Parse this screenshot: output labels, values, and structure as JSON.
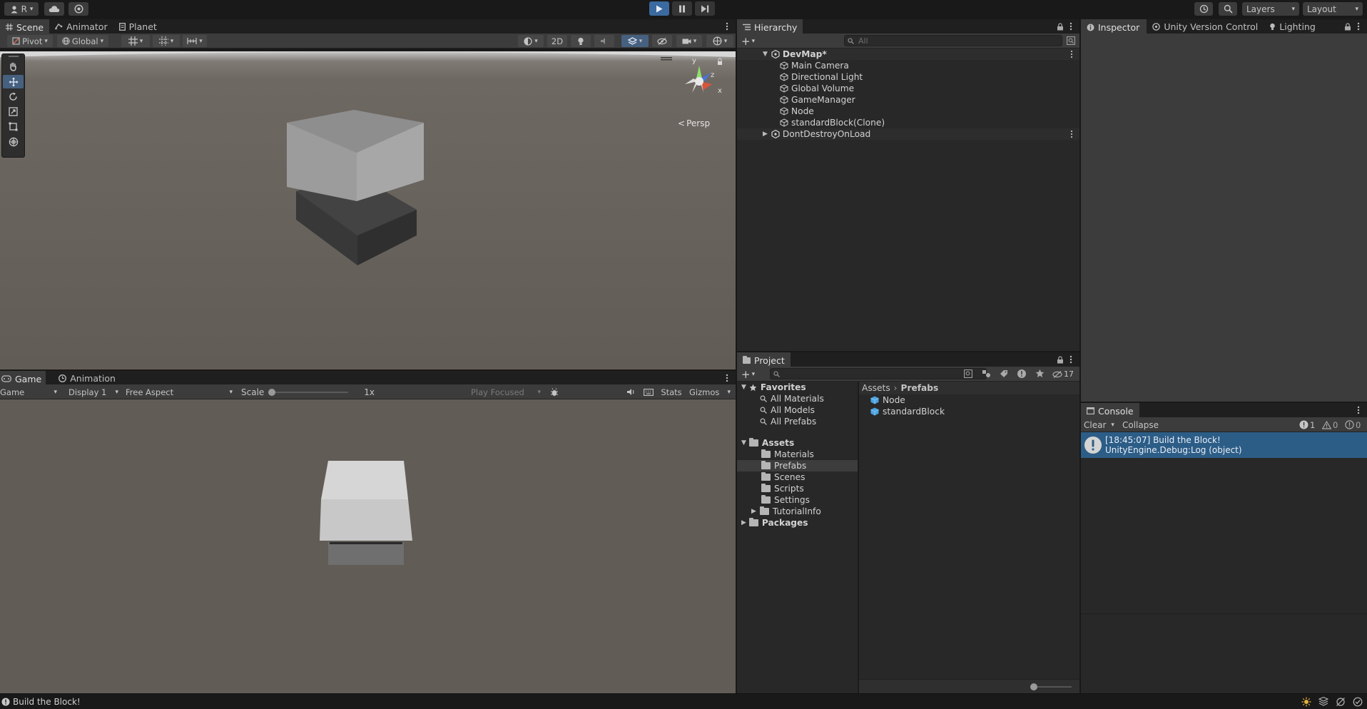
{
  "toolbar": {
    "account_label": "R",
    "layers_label": "Layers",
    "layout_label": "Layout"
  },
  "scene_tabs": [
    {
      "label": "Scene"
    },
    {
      "label": "Animator"
    },
    {
      "label": "Planet"
    }
  ],
  "scene_toolbar": {
    "pivot_label": "Pivot",
    "global_label": "Global",
    "mode_2d_label": "2D"
  },
  "scene_gizmo": {
    "projection_label": "Persp",
    "axis_y": "y",
    "axis_z": "z",
    "axis_x": "x"
  },
  "game_tabs": [
    {
      "label": "Game"
    },
    {
      "label": "Animation"
    }
  ],
  "game_toolbar": {
    "game_label": "Game",
    "display_label": "Display 1",
    "aspect_label": "Free Aspect",
    "scale_label": "Scale",
    "scale_value": "1x",
    "play_focused_label": "Play Focused",
    "stats_label": "Stats",
    "gizmos_label": "Gizmos"
  },
  "hierarchy": {
    "title": "Hierarchy",
    "search_placeholder": "All",
    "scene_name": "DevMap*",
    "objects": [
      "Main Camera",
      "Directional Light",
      "Global Volume",
      "GameManager",
      "Node",
      "standardBlock(Clone)"
    ],
    "ddol_name": "DontDestroyOnLoad"
  },
  "project": {
    "title": "Project",
    "hidden_count": "17",
    "favorites_label": "Favorites",
    "favorites": [
      "All Materials",
      "All Models",
      "All Prefabs"
    ],
    "assets_label": "Assets",
    "asset_folders": [
      "Materials",
      "Prefabs",
      "Scenes",
      "Scripts",
      "Settings",
      "TutorialInfo"
    ],
    "packages_label": "Packages",
    "breadcrumb_root": "Assets",
    "breadcrumb_current": "Prefabs",
    "items": [
      "Node",
      "standardBlock"
    ]
  },
  "inspector_tabs": [
    {
      "label": "Inspector"
    },
    {
      "label": "Unity Version Control"
    },
    {
      "label": "Lighting"
    }
  ],
  "console": {
    "title": "Console",
    "clear_label": "Clear",
    "collapse_label": "Collapse",
    "log_count": "1",
    "warn_count": "0",
    "error_count": "0",
    "message_line1": "[18:45:07] Build the Block!",
    "message_line2": "UnityEngine.Debug:Log (object)"
  },
  "status_bar": {
    "message": "Build the Block!"
  },
  "colors": {
    "accent": "#3b6aa0",
    "selection": "#2c5d87",
    "panel": "#282828",
    "toolbar": "#3c3c3c"
  }
}
